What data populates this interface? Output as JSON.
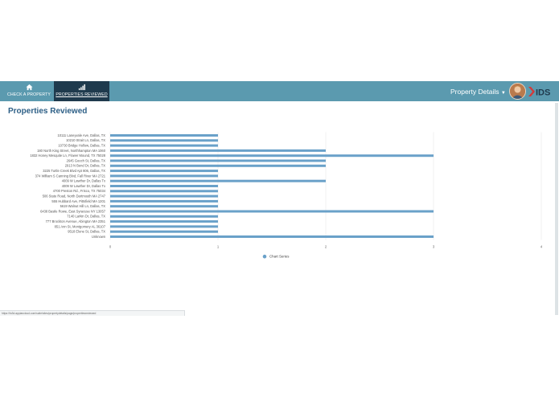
{
  "nav": {
    "tabs": [
      {
        "label": "CHECK A PROPERTY",
        "icon": "home-icon"
      },
      {
        "label": "PROPERTIES REVIEWED",
        "icon": "bar-chart-icon"
      }
    ],
    "details_menu_label": "Property Details",
    "logo_text": "IDS"
  },
  "page": {
    "title": "Properties Reviewed"
  },
  "status_url": "https://fu3d.appiancloud.com/suite/sites/propertydetails/page/propertiesreviewed",
  "colors": {
    "navbar": "#5b9aaf",
    "active_tab": "#1f3a4d",
    "title": "#2d5f86",
    "bar": "#6aa1c9"
  },
  "chart_data": {
    "type": "bar",
    "orientation": "horizontal",
    "categories": [
      "10111 Laneyvale Ave, Dallas, TX",
      "10210 Strait Ln, Dallas, TX",
      "10730 Bridge Hollow, Dallas, TX",
      "180 North King Street, Northhampton MA 1060",
      "1832 Honey Mesquite Ln, Flower Mound, TX 75028",
      "2645 Gooch St, Dallas, TX",
      "2913 N Bend Dr, Dallas, TX",
      "3225 Turtle Creek Blvd Apt 806, Dallas, TX",
      "374 William S Canning Blvd, Fall River MA 2721",
      "4009 W Lawther Dr, Dallas Tx",
      "4009 W Lawther Dr, Dallas Tx",
      "4700 Preston Rd., Frisco, TX 75034",
      "506 State Road, North Dartmouth MA 2747",
      "555 Hubbard Ave, Pittsfield MA 1201",
      "5619 Walnut Hill Ln, Dallas, TX",
      "6438 Basile Rowe, East Syracuse NY 13057",
      "7140 Larkin Dr, Dallas, TX",
      "777 Brockton Avenue, Abington MA 2351",
      "851 Ann St, Montgomery AL 36107",
      "9518 Elene St, Dallas, TX",
      "Unknown"
    ],
    "series": [
      {
        "name": "Chart Series",
        "values": [
          1,
          1,
          1,
          2,
          3,
          2,
          2,
          1,
          1,
          2,
          1,
          1,
          1,
          1,
          1,
          3,
          1,
          1,
          1,
          1,
          3
        ]
      }
    ],
    "xlim": [
      0,
      4
    ],
    "xticks": [
      "0",
      "1",
      "2",
      "3",
      "4"
    ],
    "grid": true,
    "legend": "bottom"
  }
}
